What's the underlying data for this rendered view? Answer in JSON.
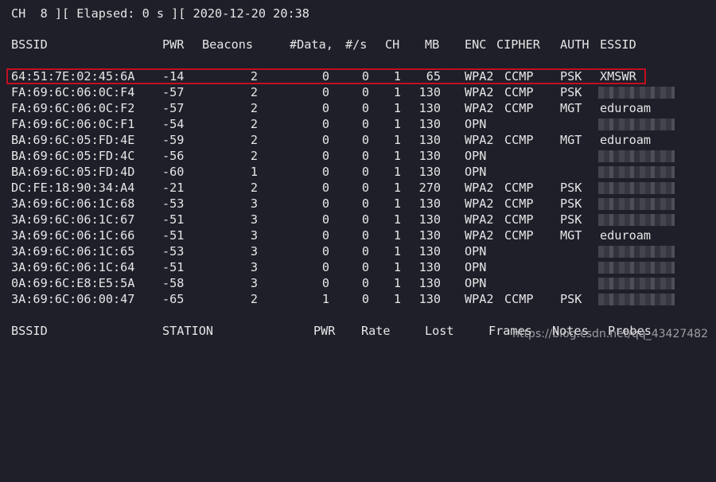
{
  "status": "CH  8 ][ Elapsed: 0 s ][ 2020-12-20 20:38",
  "ap_headers": {
    "bssid": "BSSID",
    "pwr": "PWR",
    "beacons": "Beacons",
    "data": "#Data,",
    "s": "#/s",
    "ch": "CH",
    "mb": "MB",
    "enc": "ENC",
    "cipher": "CIPHER",
    "auth": "AUTH",
    "essid": "ESSID"
  },
  "ap_rows": [
    {
      "bssid": "64:51:7E:02:45:6A",
      "pwr": "-14",
      "beacons": "2",
      "data": "0",
      "s": "0",
      "ch": "1",
      "mb": "65",
      "enc": "WPA2",
      "cipher": "CCMP",
      "auth": "PSK",
      "essid": "XMSWR"
    },
    {
      "bssid": "FA:69:6C:06:0C:F4",
      "pwr": "-57",
      "beacons": "2",
      "data": "0",
      "s": "0",
      "ch": "1",
      "mb": "130",
      "enc": "WPA2",
      "cipher": "CCMP",
      "auth": "PSK",
      "essid": ""
    },
    {
      "bssid": "FA:69:6C:06:0C:F2",
      "pwr": "-57",
      "beacons": "2",
      "data": "0",
      "s": "0",
      "ch": "1",
      "mb": "130",
      "enc": "WPA2",
      "cipher": "CCMP",
      "auth": "MGT",
      "essid": "eduroam"
    },
    {
      "bssid": "FA:69:6C:06:0C:F1",
      "pwr": "-54",
      "beacons": "2",
      "data": "0",
      "s": "0",
      "ch": "1",
      "mb": "130",
      "enc": "OPN",
      "cipher": "",
      "auth": "",
      "essid": ""
    },
    {
      "bssid": "BA:69:6C:05:FD:4E",
      "pwr": "-59",
      "beacons": "2",
      "data": "0",
      "s": "0",
      "ch": "1",
      "mb": "130",
      "enc": "WPA2",
      "cipher": "CCMP",
      "auth": "MGT",
      "essid": "eduroam"
    },
    {
      "bssid": "BA:69:6C:05:FD:4C",
      "pwr": "-56",
      "beacons": "2",
      "data": "0",
      "s": "0",
      "ch": "1",
      "mb": "130",
      "enc": "OPN",
      "cipher": "",
      "auth": "",
      "essid": ""
    },
    {
      "bssid": "BA:69:6C:05:FD:4D",
      "pwr": "-60",
      "beacons": "1",
      "data": "0",
      "s": "0",
      "ch": "1",
      "mb": "130",
      "enc": "OPN",
      "cipher": "",
      "auth": "",
      "essid": ""
    },
    {
      "bssid": "DC:FE:18:90:34:A4",
      "pwr": "-21",
      "beacons": "2",
      "data": "0",
      "s": "0",
      "ch": "1",
      "mb": "270",
      "enc": "WPA2",
      "cipher": "CCMP",
      "auth": "PSK",
      "essid": ""
    },
    {
      "bssid": "3A:69:6C:06:1C:68",
      "pwr": "-53",
      "beacons": "3",
      "data": "0",
      "s": "0",
      "ch": "1",
      "mb": "130",
      "enc": "WPA2",
      "cipher": "CCMP",
      "auth": "PSK",
      "essid": ""
    },
    {
      "bssid": "3A:69:6C:06:1C:67",
      "pwr": "-51",
      "beacons": "3",
      "data": "0",
      "s": "0",
      "ch": "1",
      "mb": "130",
      "enc": "WPA2",
      "cipher": "CCMP",
      "auth": "PSK",
      "essid": ""
    },
    {
      "bssid": "3A:69:6C:06:1C:66",
      "pwr": "-51",
      "beacons": "3",
      "data": "0",
      "s": "0",
      "ch": "1",
      "mb": "130",
      "enc": "WPA2",
      "cipher": "CCMP",
      "auth": "MGT",
      "essid": "eduroam"
    },
    {
      "bssid": "3A:69:6C:06:1C:65",
      "pwr": "-53",
      "beacons": "3",
      "data": "0",
      "s": "0",
      "ch": "1",
      "mb": "130",
      "enc": "OPN",
      "cipher": "",
      "auth": "",
      "essid": ""
    },
    {
      "bssid": "3A:69:6C:06:1C:64",
      "pwr": "-51",
      "beacons": "3",
      "data": "0",
      "s": "0",
      "ch": "1",
      "mb": "130",
      "enc": "OPN",
      "cipher": "",
      "auth": "",
      "essid": ""
    },
    {
      "bssid": "0A:69:6C:E8:E5:5A",
      "pwr": "-58",
      "beacons": "3",
      "data": "0",
      "s": "0",
      "ch": "1",
      "mb": "130",
      "enc": "OPN",
      "cipher": "",
      "auth": "",
      "essid": ""
    },
    {
      "bssid": "3A:69:6C:06:00:47",
      "pwr": "-65",
      "beacons": "2",
      "data": "1",
      "s": "0",
      "ch": "1",
      "mb": "130",
      "enc": "WPA2",
      "cipher": "CCMP",
      "auth": "PSK",
      "essid": ""
    }
  ],
  "station_headers": {
    "bssid": "BSSID",
    "station": "STATION",
    "pwr": "PWR",
    "rate": "Rate",
    "lost": "Lost",
    "frames": "Frames",
    "notes": "Notes",
    "probes": "Probes"
  },
  "watermark": "https://blog.csdn.net/qq_43427482",
  "colors": {
    "background": "#1e1f29",
    "text": "#e6e6e6",
    "highlight_border": "#c01020"
  }
}
